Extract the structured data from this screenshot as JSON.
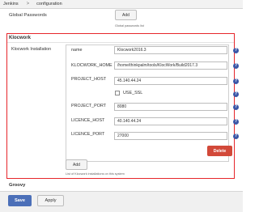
{
  "breadcrumb": {
    "root": "Jenkins",
    "separator": ">",
    "current": "configuration"
  },
  "global_passwords": {
    "title": "Global Passwords",
    "add_label": "Add",
    "note": "Global passwords list"
  },
  "klocwork": {
    "section_title": "Klocwork",
    "installation_label": "Klocwork Installation",
    "fields": {
      "name": {
        "label": "name",
        "value": "Klocwork2016.3"
      },
      "home": {
        "label": "KLOCWORK_HOME",
        "value": "/home/thinkpalm/tools/KlocWork/Build2017.3"
      },
      "project_host": {
        "label": "PROJECT_HOST",
        "value": "45.140.44.24"
      },
      "use_ssl": {
        "label": "USE_SSL",
        "checked": false
      },
      "project_port": {
        "label": "PROJECT_PORT",
        "value": "8080"
      },
      "licence_host": {
        "label": "LICENCE_HOST",
        "value": "40.140.44.24"
      },
      "licence_port": {
        "label": "LICENCE_PORT",
        "value": "27000"
      }
    },
    "help_glyph": "?",
    "delete_label": "Delete",
    "add_label": "Add",
    "list_note": "List of Klocwork installations on this system"
  },
  "groovy": {
    "title": "Groovy"
  },
  "footer": {
    "save_label": "Save",
    "apply_label": "Apply"
  },
  "colors": {
    "highlight_border": "#e6262b",
    "help_icon": "#3b57a7",
    "delete": "#d24939",
    "save": "#4b6fb8"
  }
}
